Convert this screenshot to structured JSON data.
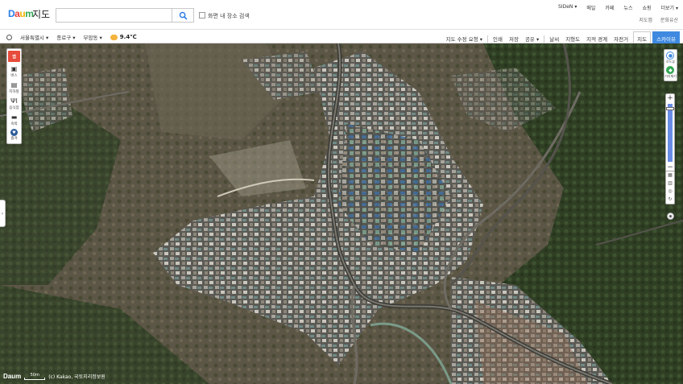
{
  "brand": {
    "logo": "Daum",
    "title": "지도"
  },
  "search": {
    "value": "",
    "placeholder": "",
    "option_label": "화면 내 장소 검색"
  },
  "topnav": [
    "SIDeN ▾",
    "메일",
    "카페",
    "뉴스",
    "쇼핑",
    "더보기 ▾"
  ],
  "subnav": [
    "지도앱",
    "문화유산"
  ],
  "location": {
    "city": "서울특별시 ▾",
    "district": "종로구 ▾",
    "dong": "부암동 ▾",
    "temperature": "9.4℃"
  },
  "tools": {
    "draw": "지도 수정 요청 ▾",
    "print": "인쇄",
    "save": "저장",
    "share": "공유 ▾",
    "layers": [
      "날씨",
      "지형도",
      "지적 경계",
      "자전거"
    ],
    "modes": [
      "지도",
      "스카이뷰"
    ],
    "active_mode": "스카이뷰"
  },
  "left_panel": {
    "items": [
      {
        "label": "버스",
        "icon": "bus-icon"
      },
      {
        "label": "지하철",
        "icon": "subway-icon"
      },
      {
        "label": "음식점",
        "icon": "restaurant-icon"
      },
      {
        "label": "숙박",
        "icon": "hotel-icon"
      },
      {
        "label": "즐겨",
        "icon": "favorites-icon"
      }
    ]
  },
  "right_panel": {
    "roadview": "로드뷰",
    "distance": "거리재기"
  },
  "footer": {
    "logo": "Daum",
    "scale": "50m",
    "copyright": "(c) Kakao, 국토지리정보원"
  },
  "colors": {
    "accent": "#3f8ae0",
    "brand_red": "#e83e3e"
  }
}
